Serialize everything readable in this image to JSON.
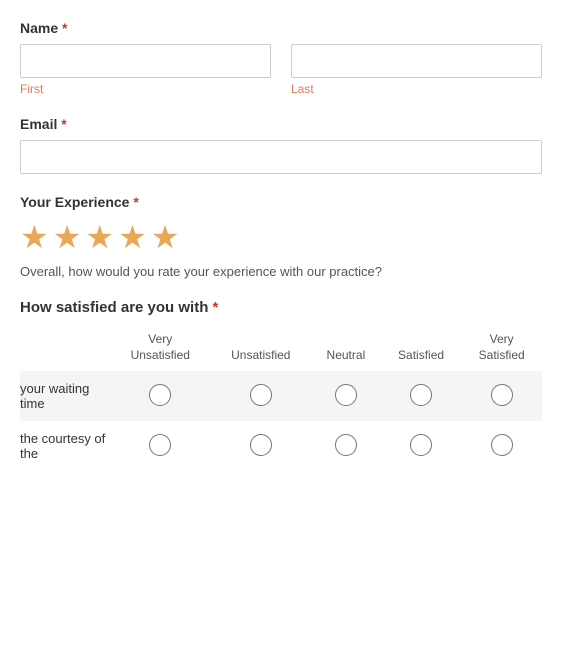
{
  "form": {
    "name_label": "Name",
    "name_first_placeholder": "",
    "name_last_placeholder": "",
    "name_first_sublabel": "First",
    "name_last_sublabel": "Last",
    "email_label": "Email",
    "email_placeholder": "",
    "experience_label": "Your Experience",
    "experience_stars_filled": 5,
    "experience_stars_total": 5,
    "experience_hint": "Overall, how would you rate your experience with our practice?",
    "satisfaction_label": "How satisfied are you with",
    "satisfaction_columns": [
      "Very Unsatisfied",
      "Unsatisfied",
      "Neutral",
      "Satisfied",
      "Very Satisfied"
    ],
    "satisfaction_rows": [
      {
        "label": "your waiting time"
      },
      {
        "label": "the courtesy of the"
      }
    ],
    "required_marker": "*"
  }
}
